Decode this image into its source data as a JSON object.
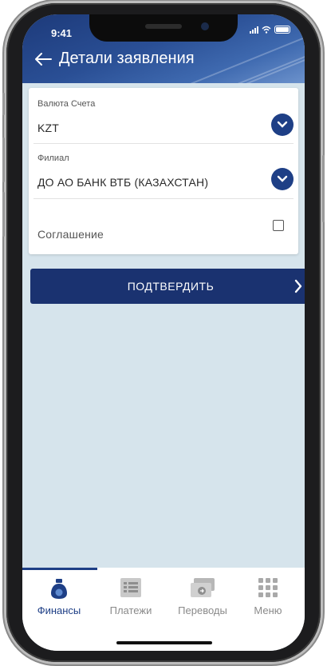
{
  "status_bar": {
    "time": "9:41"
  },
  "header": {
    "title": "Детали заявления"
  },
  "form": {
    "currency": {
      "label": "Валюта Счета",
      "value": "KZT"
    },
    "branch": {
      "label": "Филиал",
      "value": "ДО АО БАНК ВТБ (КАЗАХСТАН)"
    },
    "agreement": {
      "label": "Соглашение",
      "checked": false
    }
  },
  "confirm_button": {
    "label": "ПОДТВЕРДИТЬ"
  },
  "tabs": [
    {
      "label": "Финансы",
      "icon": "finance-bag-icon",
      "active": true
    },
    {
      "label": "Платежи",
      "icon": "payments-list-icon",
      "active": false
    },
    {
      "label": "Переводы",
      "icon": "transfer-card-icon",
      "active": false
    },
    {
      "label": "Меню",
      "icon": "menu-grid-icon",
      "active": false
    }
  ],
  "colors": {
    "primary": "#1e3f86",
    "button": "#1a3270",
    "background": "#d6e4ec"
  }
}
